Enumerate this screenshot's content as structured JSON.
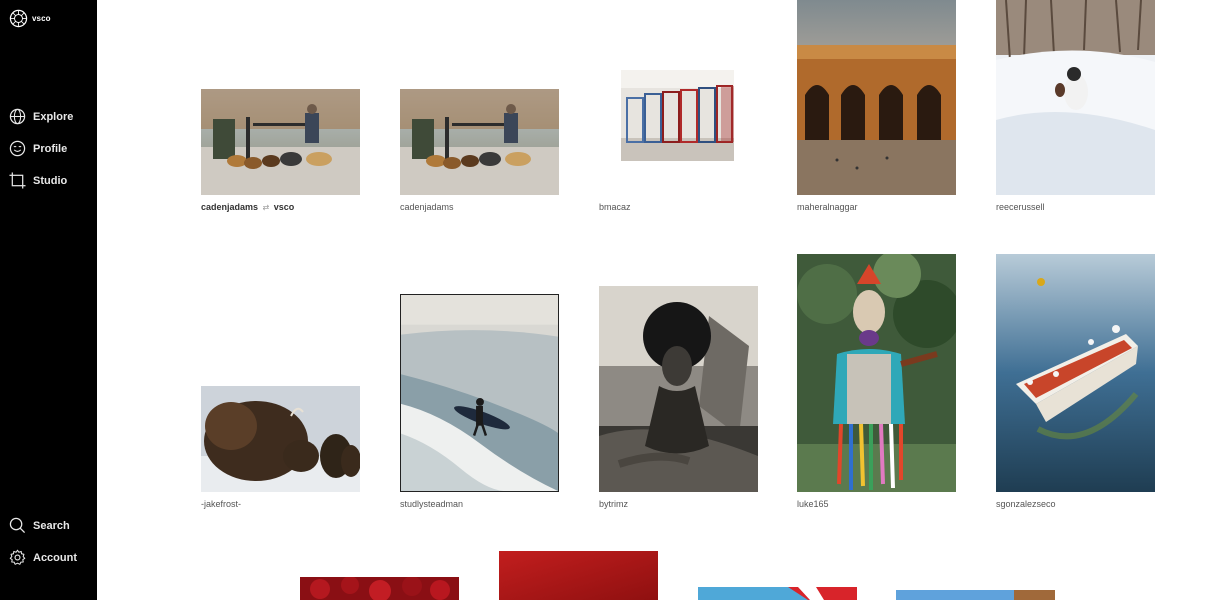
{
  "app": {
    "logo_text": "vsco"
  },
  "nav": {
    "explore": "Explore",
    "profile": "Profile",
    "studio": "Studio",
    "search": "Search",
    "account": "Account"
  },
  "grid": {
    "row1": [
      {
        "user": "cadenjadams",
        "repost_icon": "⇄",
        "repost_by": "vsco",
        "bold": true,
        "subject": "people and dogs at park gate"
      },
      {
        "user": "cadenjadams",
        "subject": "people and dogs at park gate"
      },
      {
        "user": "bmacaz",
        "subject": "stacked colorful chairs"
      },
      {
        "user": "maheralnaggar",
        "subject": "arched stone arcade at dusk"
      },
      {
        "user": "reecerussell",
        "subject": "dog running in snow"
      }
    ],
    "row2": [
      {
        "user": "-jakefrost-",
        "subject": "bison in snow"
      },
      {
        "user": "studlysteadman",
        "subject": "surfer walking into waves"
      },
      {
        "user": "bytrimz",
        "subject": "woman with afro, black and white"
      },
      {
        "user": "luke165",
        "subject": "costumed figure playing violin"
      },
      {
        "user": "sgonzalezseco",
        "subject": "red rowboat on calm water"
      }
    ]
  }
}
